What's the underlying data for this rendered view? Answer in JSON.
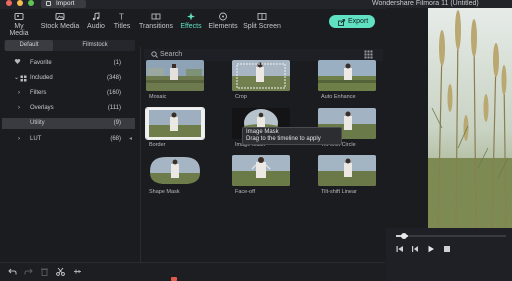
{
  "window": {
    "title": "Wondershare Filmora 11 (Untitled)",
    "traffic_lights": [
      "#ec6a5e",
      "#f4bf4f",
      "#61c554"
    ],
    "import_label": "Import"
  },
  "tabs": [
    {
      "label": "My Media",
      "icon": "media-icon"
    },
    {
      "label": "Stock Media",
      "icon": "stock-media-icon"
    },
    {
      "label": "Audio",
      "icon": "music-note-icon"
    },
    {
      "label": "Titles",
      "icon": "titles-icon"
    },
    {
      "label": "Transitions",
      "icon": "transitions-icon"
    },
    {
      "label": "Effects",
      "icon": "effects-sparkle-icon",
      "active": true
    },
    {
      "label": "Elements",
      "icon": "elements-icon"
    },
    {
      "label": "Split Screen",
      "icon": "split-screen-icon"
    }
  ],
  "export_label": "Export",
  "sidebar": {
    "segments": [
      "Default",
      "Filmstock"
    ],
    "tree": [
      {
        "label": "Favorite",
        "count": "(1)"
      },
      {
        "label": "Included",
        "count": "(348)"
      },
      {
        "label": "Filters",
        "count": "(160)"
      },
      {
        "label": "Overlays",
        "count": "(111)"
      },
      {
        "label": "Utility",
        "count": "(9)",
        "selected": true
      },
      {
        "label": "LUT",
        "count": "(68)"
      }
    ]
  },
  "search": {
    "placeholder": "Search"
  },
  "effects": [
    {
      "label": "Mosaic"
    },
    {
      "label": "Crop"
    },
    {
      "label": "Auto Enhance"
    },
    {
      "label": "Border",
      "selected": true
    },
    {
      "label": "Image Mask"
    },
    {
      "label": "Tilt-shift Circle"
    },
    {
      "label": "Shape Mask"
    },
    {
      "label": "Face-off"
    },
    {
      "label": "Tilt-shift Linear"
    }
  ],
  "tooltip": {
    "title": "Image Mask",
    "hint": "Drag to the timeline to apply"
  },
  "colors": {
    "accent": "#5fe1c2",
    "background": "#1b1c20",
    "panel": "#232429"
  }
}
